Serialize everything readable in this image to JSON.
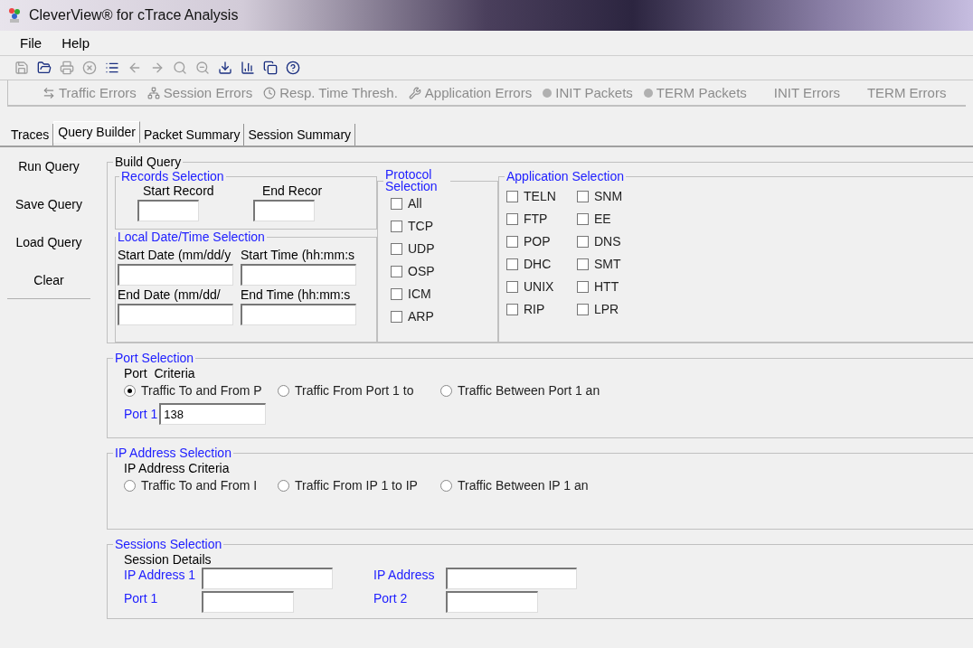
{
  "window": {
    "title": "CleverView® for cTrace Analysis"
  },
  "menu": [
    "File",
    "Help"
  ],
  "toolbar": [
    {
      "disabled": true
    },
    {
      "disabled": false
    },
    {
      "disabled": true
    },
    {
      "disabled": true
    },
    {
      "disabled": false
    },
    {
      "disabled": true
    },
    {
      "disabled": true
    },
    {
      "disabled": true
    },
    {
      "disabled": true
    },
    {
      "disabled": false
    },
    {
      "disabled": false
    },
    {
      "disabled": false
    },
    {
      "disabled": false
    }
  ],
  "reports": [
    {
      "kind": "icon",
      "label": "Traffic Errors",
      "disabled": true
    },
    {
      "kind": "icon",
      "label": "Session Errors",
      "disabled": true
    },
    {
      "kind": "icon",
      "label": "Resp. Time Thresh.",
      "disabled": true
    },
    {
      "kind": "icon",
      "label": "Application Errors",
      "disabled": true
    },
    {
      "kind": "dot",
      "label": "INIT Packets",
      "disabled": true
    },
    {
      "kind": "dot",
      "label": "TERM Packets",
      "disabled": true
    },
    {
      "kind": "plain",
      "label": "INIT Errors",
      "disabled": true
    },
    {
      "kind": "plain",
      "label": "TERM Errors",
      "disabled": true
    }
  ],
  "tabs": [
    {
      "label": "Traces",
      "selected": false
    },
    {
      "label": "Query Builder",
      "selected": true
    },
    {
      "label": "Packet Summary",
      "selected": false
    },
    {
      "label": "Session Summary",
      "selected": false
    }
  ],
  "sidebar": [
    "Run Query",
    "Save Query",
    "Load Query",
    "Clear"
  ],
  "build_query": {
    "title": "Build Query",
    "records": {
      "title": "Records Selection",
      "fields": [
        "Start Record",
        "End Recor"
      ]
    },
    "datetime": {
      "title": "Local Date/Time Selection",
      "fields": [
        "Start Date (mm/dd/y",
        "Start Time (hh:mm:s",
        "End Date (mm/dd/",
        "End Time (hh:mm:s"
      ]
    },
    "protocol": {
      "title": "Protocol Selection",
      "options": [
        {
          "label": "All",
          "checked": false
        },
        {
          "label": "TCP",
          "checked": false
        },
        {
          "label": "UDP",
          "checked": false
        },
        {
          "label": "OSP",
          "checked": false
        },
        {
          "label": "ICM",
          "checked": false
        },
        {
          "label": "ARP",
          "checked": false
        }
      ]
    },
    "application": {
      "title": "Application Selection",
      "options": [
        {
          "label": "TELN",
          "checked": false
        },
        {
          "label": "SNM",
          "checked": false
        },
        {
          "label": "FTP",
          "checked": false
        },
        {
          "label": "EE",
          "checked": false
        },
        {
          "label": "POP",
          "checked": false
        },
        {
          "label": "DNS",
          "checked": false
        },
        {
          "label": "DHC",
          "checked": false
        },
        {
          "label": "SMT",
          "checked": false
        },
        {
          "label": "UNIX",
          "checked": false
        },
        {
          "label": "HTT",
          "checked": false
        },
        {
          "label": "RIP",
          "checked": false
        },
        {
          "label": "LPR",
          "checked": false
        }
      ]
    },
    "port": {
      "title": "Port Selection",
      "criteria": "Port  Criteria",
      "options": [
        {
          "label": "Traffic To and From P",
          "selected": true
        },
        {
          "label": "Traffic From Port 1 to",
          "selected": false
        },
        {
          "label": "Traffic Between Port 1 an",
          "selected": false
        }
      ],
      "field": {
        "label": "Port 1",
        "value": "138"
      }
    },
    "ip": {
      "title": "IP Address Selection",
      "criteria": "IP Address Criteria",
      "options": [
        {
          "label": "Traffic To and From I",
          "selected": false
        },
        {
          "label": "Traffic From IP 1 to IP",
          "selected": false
        },
        {
          "label": "Traffic Between IP 1 an",
          "selected": false
        }
      ]
    },
    "sessions": {
      "title": "Sessions Selection",
      "subtitle": "Session Details",
      "fields": [
        {
          "label": "IP Address 1",
          "kind": "wide"
        },
        {
          "label": "IP Address",
          "kind": "wide"
        },
        {
          "label": "Port 1",
          "kind": "narrow"
        },
        {
          "label": "Port 2",
          "kind": "narrow"
        }
      ]
    }
  }
}
